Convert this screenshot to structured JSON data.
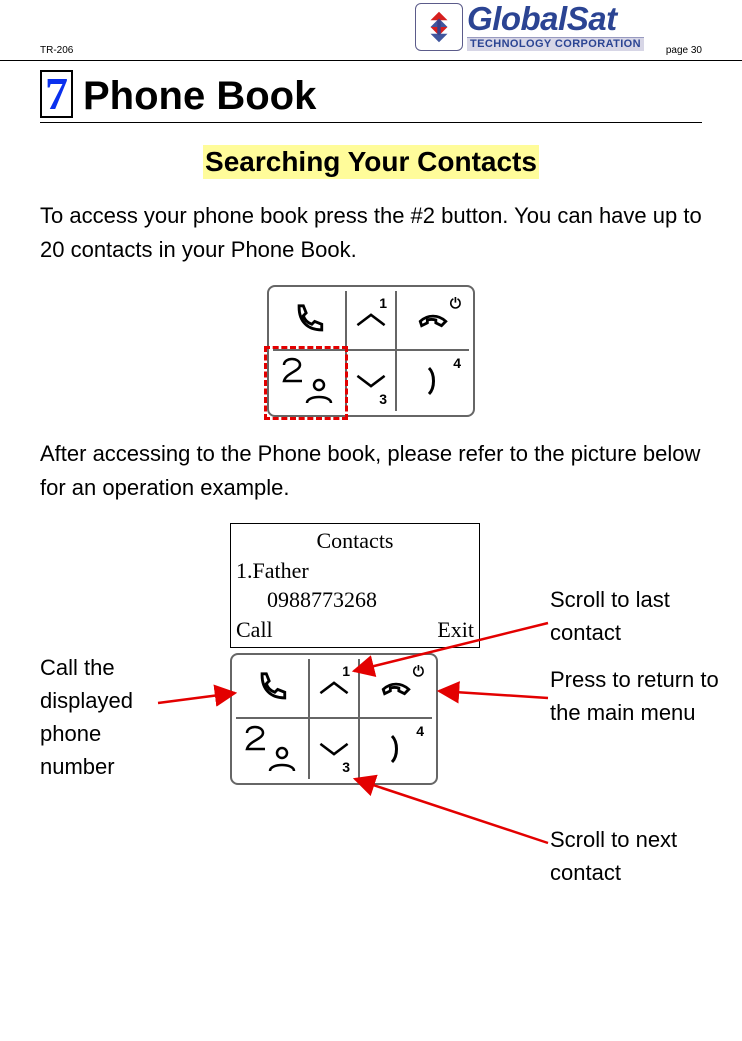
{
  "header": {
    "model": "TR-206",
    "page_label": "page 30",
    "logo_top": "GlobalSat",
    "logo_bottom": "TECHNOLOGY CORPORATION"
  },
  "chapter": {
    "number": "7",
    "title": "Phone Book"
  },
  "subheading": "Searching Your Contacts",
  "para1": "To access your phone book press the #2 button. You can have up to 20 contacts in your Phone Book.",
  "para2": "After accessing to the Phone book, please refer to the picture below for an operation example.",
  "keypad": {
    "sup1": "1",
    "sup3": "3",
    "sup4": "4",
    "num2_glyph": "2",
    "power_glyph": "⏻"
  },
  "screen": {
    "title": "Contacts",
    "row1": "1.Father",
    "number": "0988773268",
    "left_soft": "Call",
    "right_soft": "Exit"
  },
  "annot": {
    "left": "Call the displayed phone number",
    "right1": "Scroll to last contact",
    "right2": "Press to return to the main menu",
    "right3": "Scroll to next contact"
  }
}
